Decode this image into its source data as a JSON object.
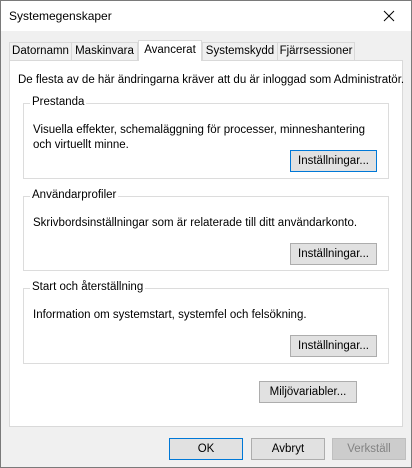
{
  "window": {
    "title": "Systemegenskaper"
  },
  "tabs": [
    {
      "label": "Datornamn"
    },
    {
      "label": "Maskinvara"
    },
    {
      "label": "Avancerat"
    },
    {
      "label": "Systemskydd"
    },
    {
      "label": "Fjärrsessioner"
    }
  ],
  "active_tab": "Avancerat",
  "intro_text": "De flesta av de här ändringarna kräver att du är inloggad som Administratör.",
  "groups": {
    "performance": {
      "title": "Prestanda",
      "description": "Visuella effekter, schemaläggning för processer, minneshantering och virtuellt minne.",
      "button": "Inställningar..."
    },
    "user_profiles": {
      "title": "Användarprofiler",
      "description": "Skrivbordsinställningar som är relaterade till ditt användarkonto.",
      "button": "Inställningar..."
    },
    "startup_recovery": {
      "title": "Start och återställning",
      "description": "Information om systemstart, systemfel och felsökning.",
      "button": "Inställningar..."
    }
  },
  "env_button": "Miljövariabler...",
  "footer": {
    "ok": "OK",
    "cancel": "Avbryt",
    "apply": "Verkställ"
  },
  "colors": {
    "focus_border": "#0078d7",
    "button_face": "#e1e1e1",
    "disabled_text": "#838383"
  }
}
